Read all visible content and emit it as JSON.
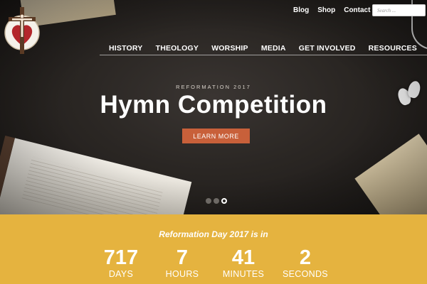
{
  "util_nav": [
    "Blog",
    "Shop",
    "Contact"
  ],
  "search": {
    "placeholder": "Search ..."
  },
  "main_nav": [
    "HISTORY",
    "THEOLOGY",
    "WORSHIP",
    "MEDIA",
    "GET INVOLVED",
    "RESOURCES"
  ],
  "hero": {
    "eyebrow": "REFORMATION 2017",
    "title": "Hymn Competition",
    "cta": "LEARN MORE",
    "slides": 3,
    "active_slide": 3
  },
  "countdown": {
    "title": "Reformation Day 2017 is in",
    "units": [
      {
        "value": "717",
        "label": "DAYS"
      },
      {
        "value": "7",
        "label": "HOURS"
      },
      {
        "value": "41",
        "label": "MINUTES"
      },
      {
        "value": "2",
        "label": "SECONDS"
      }
    ]
  },
  "colors": {
    "accent": "#c8603a",
    "band": "#e5b33f",
    "hero_bg": "#2a2623"
  },
  "icons": [
    "crucifix-logo-icon"
  ]
}
